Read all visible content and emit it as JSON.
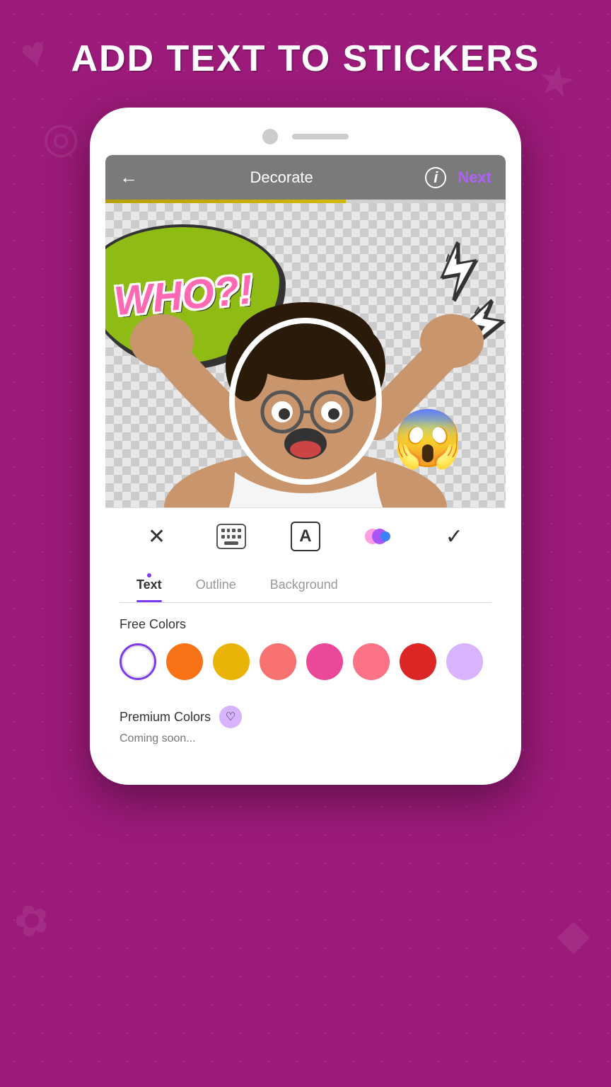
{
  "header": {
    "title": "ADD TEXT TO STICKERS"
  },
  "nav": {
    "back_label": "←",
    "title": "Decorate",
    "info_label": "i",
    "next_label": "Next"
  },
  "progress": {
    "percent": 60
  },
  "stickers": {
    "speech_bubble_text": "WHO?!",
    "emoji": "😱"
  },
  "toolbar": {
    "close_label": "✕",
    "check_label": "✓",
    "font_label": "A"
  },
  "tabs": [
    {
      "id": "text",
      "label": "Text",
      "active": true
    },
    {
      "id": "outline",
      "label": "Outline",
      "active": false
    },
    {
      "id": "background",
      "label": "Background",
      "active": false
    }
  ],
  "free_colors": {
    "label": "Free Colors",
    "swatches": [
      {
        "id": "white",
        "hex": "#ffffff",
        "selected": true
      },
      {
        "id": "orange",
        "hex": "#f97316",
        "selected": false
      },
      {
        "id": "yellow",
        "hex": "#eab308",
        "selected": false
      },
      {
        "id": "salmon",
        "hex": "#f87171",
        "selected": false
      },
      {
        "id": "pink",
        "hex": "#ec4899",
        "selected": false
      },
      {
        "id": "rose",
        "hex": "#fb7185",
        "selected": false
      },
      {
        "id": "red",
        "hex": "#dc2626",
        "selected": false
      },
      {
        "id": "lavender",
        "hex": "#d8b4fe",
        "selected": false
      },
      {
        "id": "purple",
        "hex": "#7c3aed",
        "selected": false
      }
    ]
  },
  "premium_colors": {
    "label": "Premium Colors",
    "coming_soon": "Coming soon...",
    "badge": "♡"
  }
}
